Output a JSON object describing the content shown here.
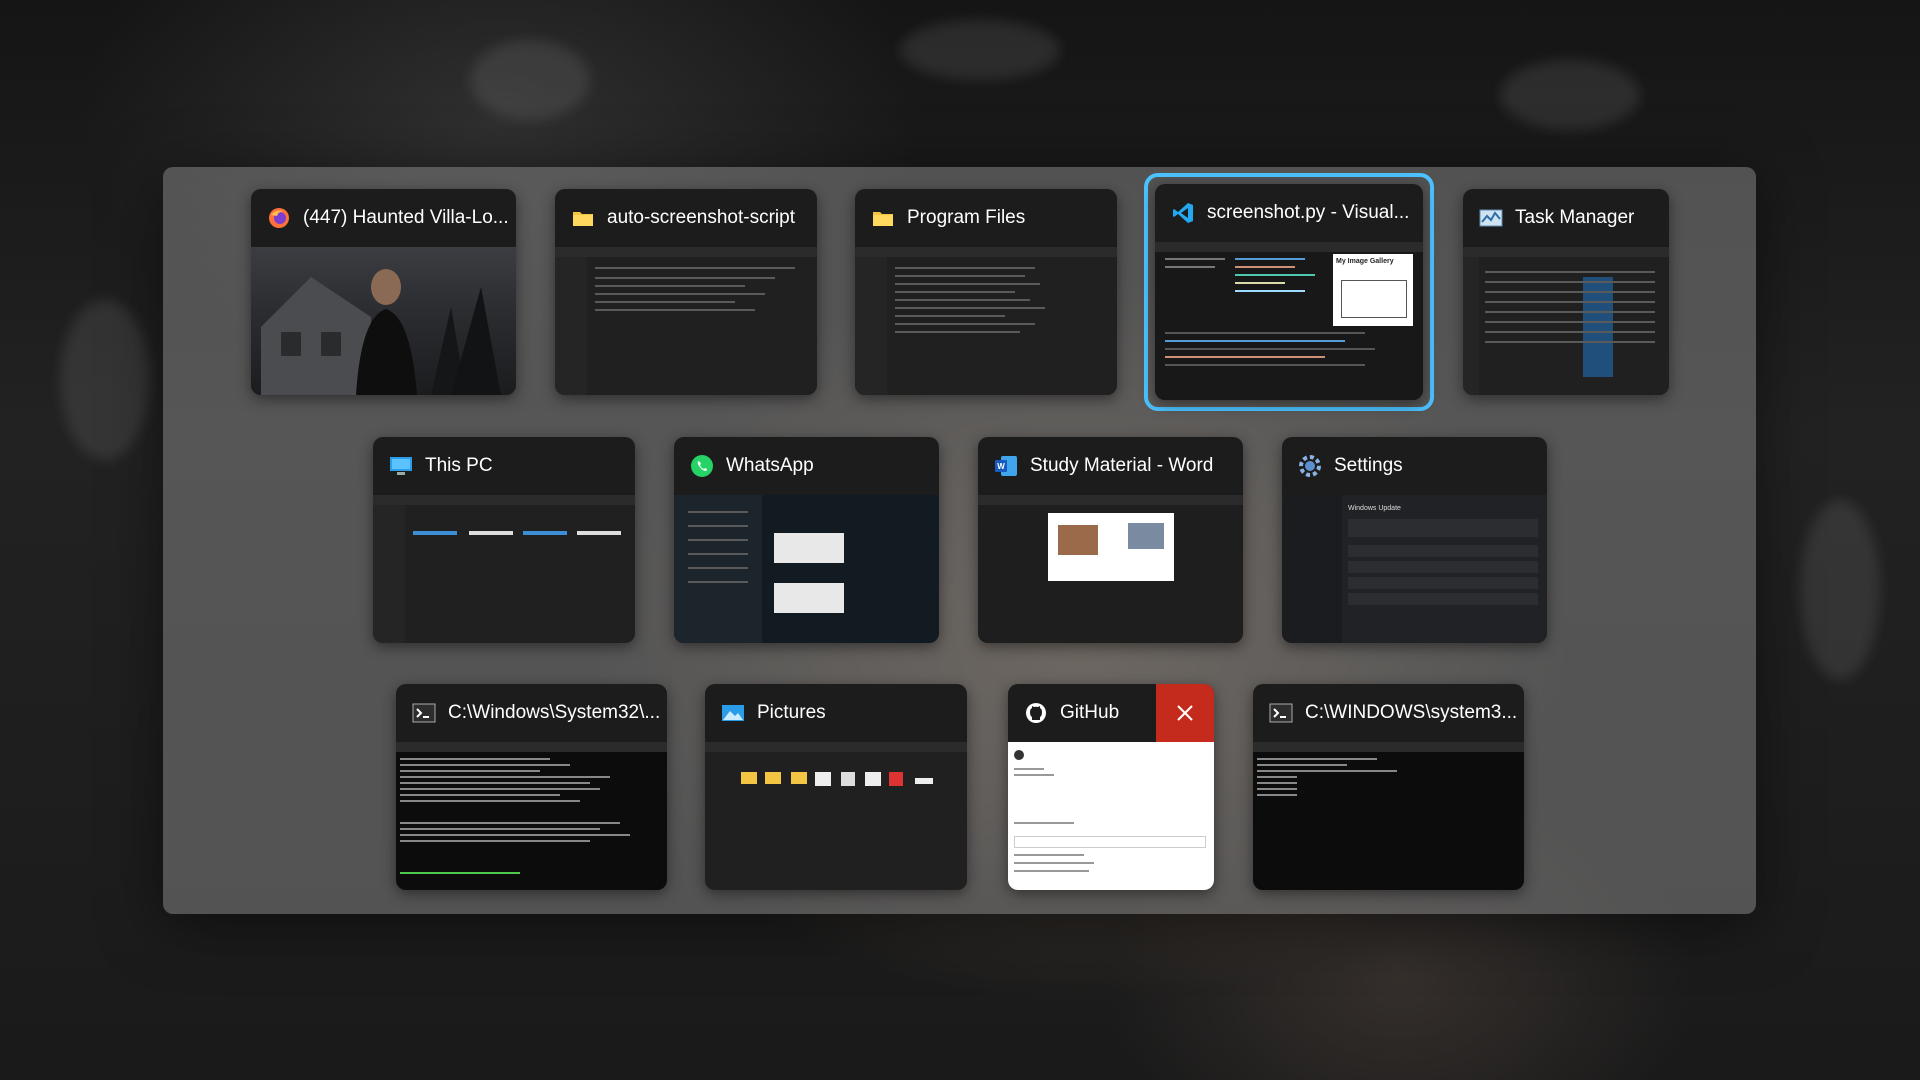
{
  "task_switcher": {
    "windows": [
      {
        "title": "(447) Haunted Villa-Lo...",
        "icon": "firefox-icon",
        "app": "Firefox"
      },
      {
        "title": "auto-screenshot-script",
        "icon": "folder-icon",
        "app": "File Explorer"
      },
      {
        "title": "Program Files",
        "icon": "folder-icon",
        "app": "File Explorer"
      },
      {
        "title": "screenshot.py - Visual...",
        "icon": "vscode-icon",
        "app": "Visual Studio Code",
        "selected": true,
        "thumb_text": "My Image Gallery"
      },
      {
        "title": "Task Manager",
        "icon": "task-manager-icon",
        "app": "Task Manager"
      },
      {
        "title": "This PC",
        "icon": "monitor-icon",
        "app": "File Explorer"
      },
      {
        "title": "WhatsApp",
        "icon": "whatsapp-icon",
        "app": "WhatsApp"
      },
      {
        "title": "Study Material - Word",
        "icon": "word-icon",
        "app": "Microsoft Word"
      },
      {
        "title": "Settings",
        "icon": "gear-icon",
        "app": "Settings",
        "thumb_text": "Windows Update"
      },
      {
        "title": "C:\\Windows\\System32\\...",
        "icon": "terminal-icon",
        "app": "Command Prompt"
      },
      {
        "title": "Pictures",
        "icon": "pictures-icon",
        "app": "File Explorer"
      },
      {
        "title": "GitHub",
        "icon": "github-icon",
        "app": "GitHub Desktop",
        "hover_close": true
      },
      {
        "title": "C:\\WINDOWS\\system3...",
        "icon": "terminal-icon",
        "app": "Command Prompt"
      }
    ]
  },
  "colors": {
    "selection": "#4cc2ff",
    "close_hover": "#c42b1c",
    "panel": "#767676"
  }
}
